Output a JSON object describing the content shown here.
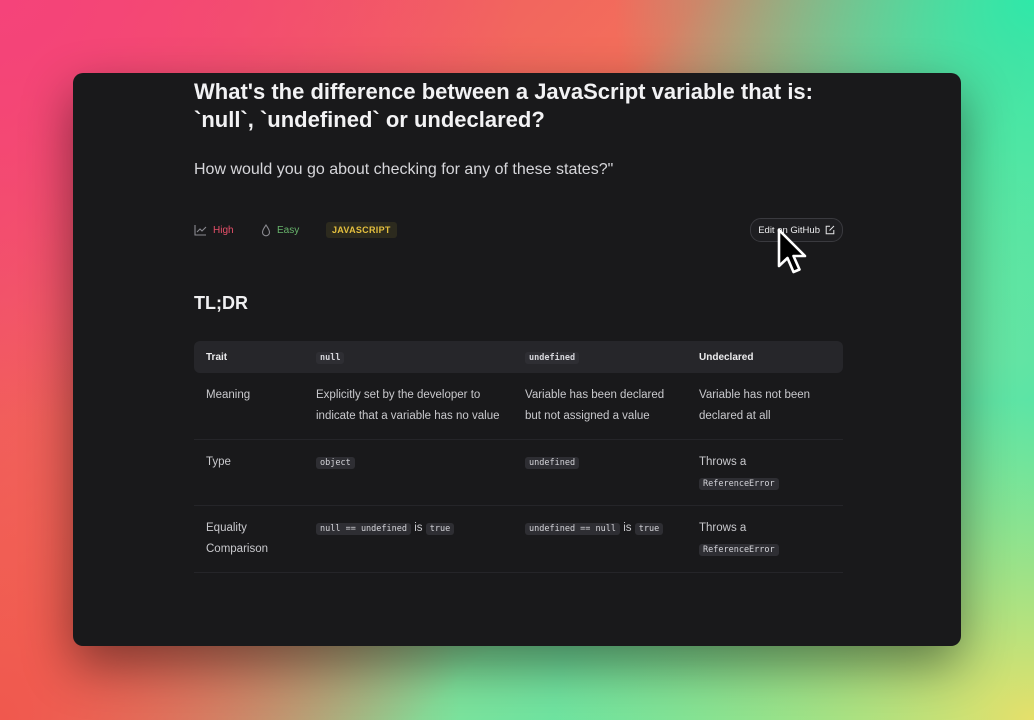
{
  "question": {
    "title": "What's the difference between a JavaScript variable that is: `null`, `undefined` or undeclared?",
    "subtitle": "How would you go about checking for any of these states?\""
  },
  "meta": {
    "importance": "High",
    "difficulty": "Easy",
    "topic": "JAVASCRIPT",
    "edit_label": "Edit on GitHub"
  },
  "tldr": {
    "heading": "TL;DR",
    "headers": [
      "Trait",
      "null",
      "undefined",
      "Undeclared"
    ],
    "rows": [
      {
        "trait": "Meaning",
        "null": "Explicitly set by the developer to indicate that a variable has no value",
        "undefined": "Variable has been declared but not assigned a value",
        "undeclared": "Variable has not been declared at all"
      },
      {
        "trait": "Type",
        "null_code": "object",
        "undefined_code": "undefined",
        "undeclared_text": "Throws a",
        "undeclared_code": "ReferenceError"
      },
      {
        "trait_line1": "Equality",
        "trait_line2": "Comparison",
        "null_code": "null == undefined",
        "null_is": "is",
        "null_result": "true",
        "undefined_code": "undefined == null",
        "undefined_is": "is",
        "undefined_result": "true",
        "undeclared_text": "Throws a",
        "undeclared_code": "ReferenceError"
      }
    ]
  },
  "colors": {
    "importance": "#e8506a",
    "difficulty": "#67b36b",
    "topic": "#e4bf3e",
    "panel": "#19191b"
  },
  "icons": {
    "importance": "trend-chart-icon",
    "difficulty": "drop-icon",
    "edit": "external-edit-icon",
    "cursor": "mouse-pointer-icon"
  }
}
